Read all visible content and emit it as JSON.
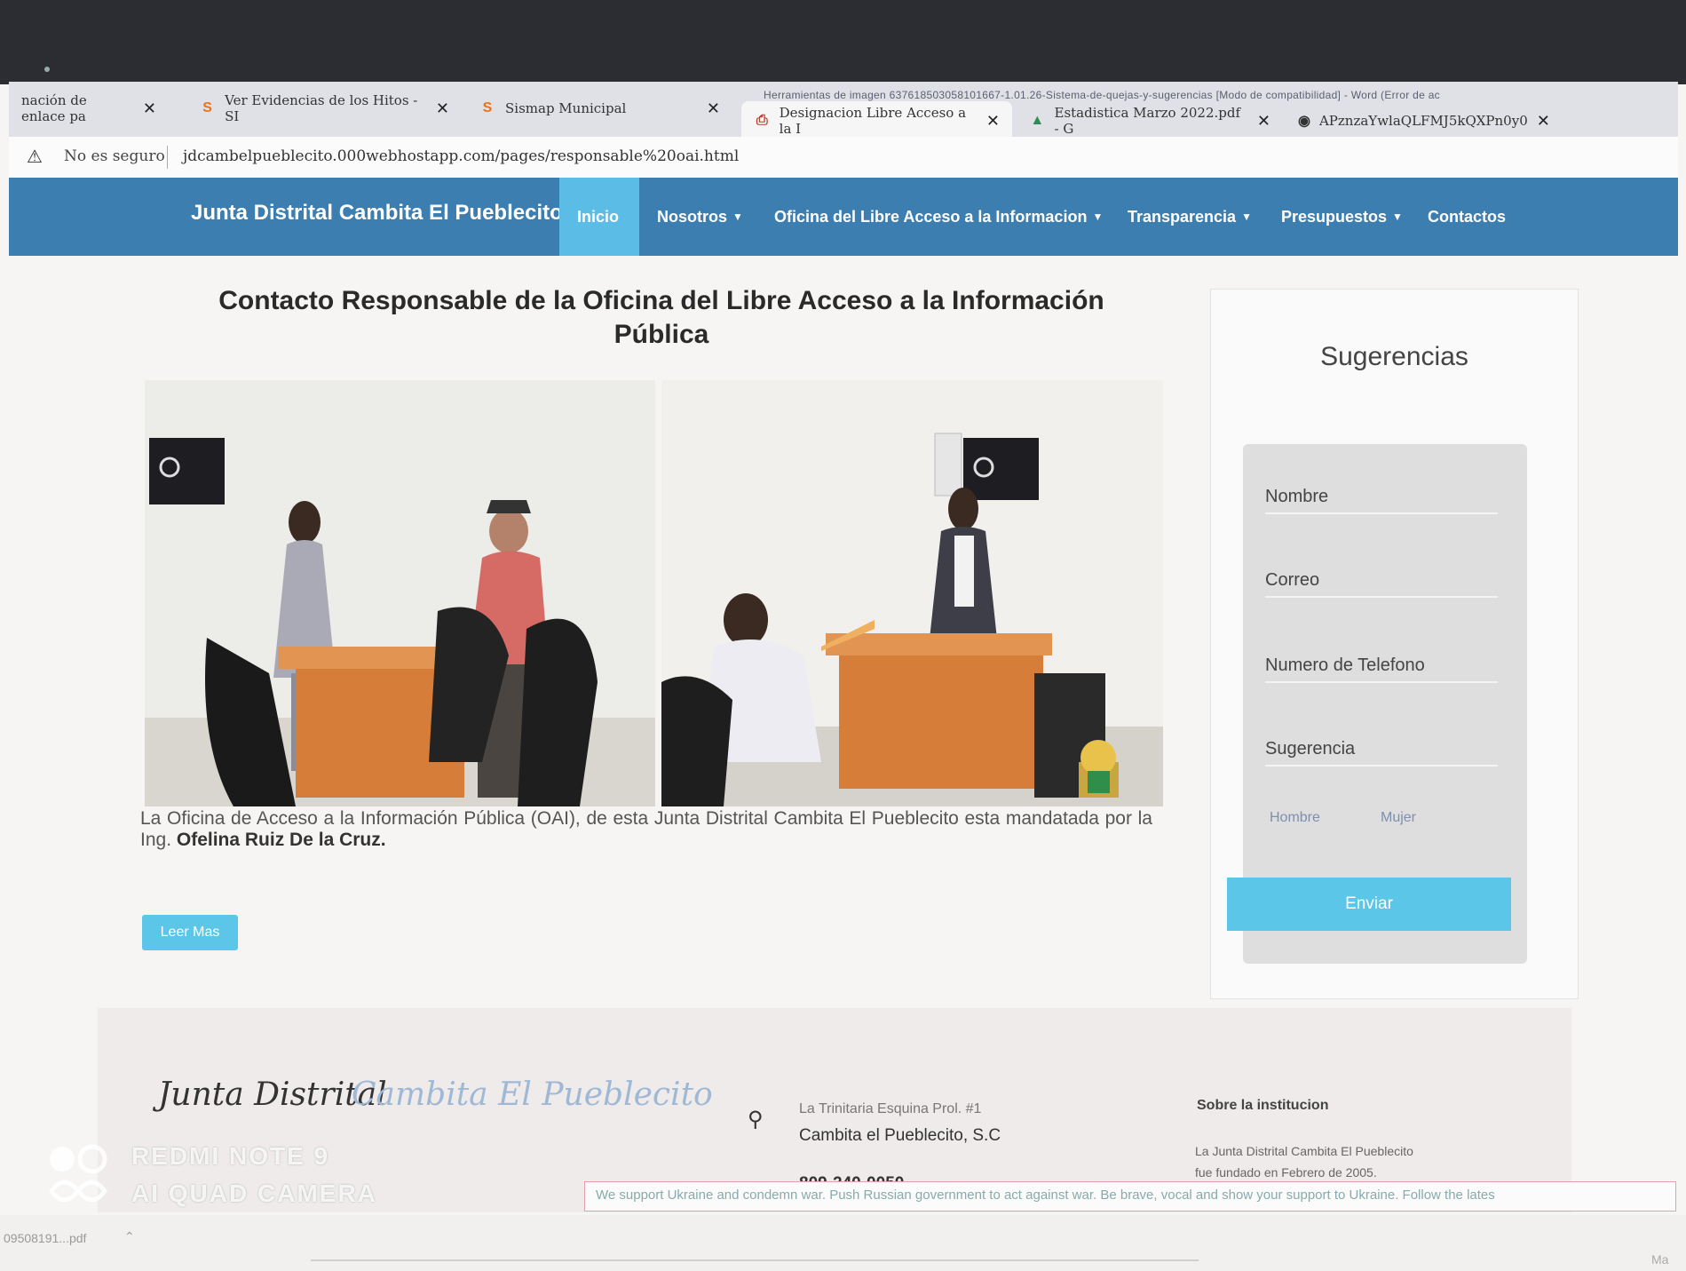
{
  "browser": {
    "tabs": [
      {
        "label": "nación de enlace pa",
        "favicon": "document-icon"
      },
      {
        "label": "Ver Evidencias de los Hitos - SI",
        "favicon": "s-logo-icon"
      },
      {
        "label": "Sismap Municipal",
        "favicon": "s-logo-icon"
      },
      {
        "label": "Designacion Libre Acceso a la I",
        "favicon": "pdf-icon",
        "active": true
      },
      {
        "label": "Estadistica Marzo 2022.pdf - G",
        "favicon": "drive-icon"
      },
      {
        "label": "APznzaYwlaQLFMJ5kQXPn0y0",
        "favicon": "globe-icon"
      }
    ],
    "window_title": "Herramientas de imagen   637618503058101667-1.01.26-Sistema-de-quejas-y-sugerencias [Modo de compatibilidad] - Word (Error de ac",
    "security_label": "No es seguro",
    "url": "jdcambelpueblecito.000webhostapp.com/pages/responsable%20oai.html"
  },
  "nav": {
    "brand": "Junta Distrital Cambita El Pueblecito",
    "items": [
      {
        "label": "Inicio",
        "active": true
      },
      {
        "label": "Nosotros",
        "dropdown": true
      },
      {
        "label": "Oficina del Libre Acceso a la Informacion",
        "dropdown": true
      },
      {
        "label": "Transparencia",
        "dropdown": true
      },
      {
        "label": "Presupuestos",
        "dropdown": true
      },
      {
        "label": "Contactos"
      }
    ]
  },
  "main": {
    "title": "Contacto Responsable de la Oficina del Libre Acceso a la Información Pública",
    "description_prefix": "La Oficina de Acceso a la Información Pública (OAI), de esta Junta Distrital Cambita El Pueblecito esta mandatada por la Ing.",
    "description_name": "Ofelina Ruiz De la Cruz.",
    "read_more": "Leer Mas"
  },
  "sidebar": {
    "title": "Sugerencias",
    "fields": [
      "Nombre",
      "Correo",
      "Numero de Telefono",
      "Sugerencia"
    ],
    "radio_options": [
      "Hombre",
      "Mujer"
    ],
    "submit": "Enviar"
  },
  "footer": {
    "name_part1": "Junta Distrital",
    "name_part2": "Cambita El Pueblecito",
    "address_line1": "La Trinitaria Esquina Prol. #1",
    "address_line2": "Cambita el Pueblecito, S.C",
    "phone_partial": "809-240-0050",
    "about_heading": "Sobre la institucion",
    "about_line1": "La Junta Distrital Cambita El Pueblecito",
    "about_line2": "fue fundado en Febrero de 2005."
  },
  "banner": "We support Ukraine and condemn war. Push Russian government to act against war. Be brave, vocal and show your support to Ukraine. Follow the lates",
  "download": {
    "filename": "09508191...pdf"
  },
  "corner_text": "Ma",
  "watermark": {
    "line1": "REDMI NOTE 9",
    "line2": "AI QUAD CAMERA"
  },
  "colors": {
    "nav": "#3d7eb0",
    "accent": "#5bc6e8",
    "active_nav": "#5bbce5"
  }
}
